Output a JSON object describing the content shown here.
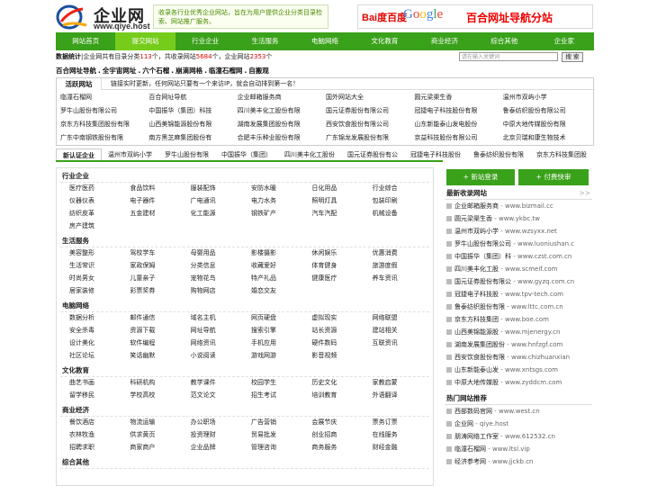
{
  "header": {
    "logo_cn": "企业网",
    "logo_en": "www.qiye.host",
    "intro": "收录各行业优秀企业网站，旨在为用户提供企业分类目录检索、网站推广服务。",
    "banner": {
      "baidu": "Bai度百度",
      "google": "Google",
      "title": "百合网址导航分站"
    }
  },
  "nav": [
    "网站首页",
    "提交网站",
    "行业企业",
    "生活服务",
    "电脑网络",
    "文化教育",
    "商业经济",
    "综合其他",
    "企业家"
  ],
  "stats": {
    "label": "数据统计",
    "text1": "企业网共有目录分类",
    "cats": "113",
    "text2": "个，共收录网站",
    "sites": "5684",
    "text3": "个，企业网站",
    "corp": "2353",
    "text4": "个"
  },
  "search": {
    "placeholder": "请在输入关键词",
    "button": "搜 索"
  },
  "favorites": [
    "百合网址导航",
    "全宇宙网址",
    "六个石榴",
    "崩滴网格",
    "临潼石榴网",
    "自搬观"
  ],
  "live": {
    "title": "活跃网站",
    "desc": "链接实时更新，任何网站只要有一个来访IP，就会自动排到第一名！",
    "links": [
      "临潼石榴网",
      "百合网址导航",
      "企业邮箱服务商",
      "国外网站大全",
      "圆元梁渠生香",
      "温州市双屿小学",
      "罗牛山股份有限公司",
      "中国振华（集团）科技",
      "四川美丰化工股份有限",
      "国元证券股份有限公司",
      "冠捷电子科技股份有限",
      "鲁泰纺织股份有限公司",
      "京东方科技集团股份有限",
      "山西美锦能源股份有限",
      "湖南发展集团股份有限",
      "西安饮食股份有限公司",
      "山东新能泰山发电股份",
      "中原大地传媒股份有限",
      "广东中南钢铁股份有限",
      "南方黑芝麻集团股份有",
      "合肥丰乐种业股份有限",
      "广东锦龙发展股份有限",
      "京益科技股份有限公司",
      "北京贝瑞和康生物技术"
    ]
  },
  "tabs": [
    "新认证企业",
    "温州市双屿小学",
    "罗牛山股份有限",
    "中国振华（集团）",
    "四川美丰化工股份",
    "国元证券股份有公",
    "冠捷电子科技股份",
    "鲁泰纺织股份有限",
    "京东方科技集团股"
  ],
  "side_buttons": {
    "submit": "+ 新站登录",
    "apply": "+ 付费快审"
  },
  "categories": [
    {
      "title": "行业企业",
      "items": [
        "医疗医药",
        "食品饮料",
        "服装配饰",
        "安防水暖",
        "日化用品",
        "行业综合",
        "仪器仪表",
        "电子器件",
        "广电通讯",
        "电力水务",
        "照明灯具",
        "包装印刷",
        "纺织皮革",
        "五金建材",
        "化工能源",
        "钢铁矿产",
        "汽车汽配",
        "机械设备",
        "房产建筑"
      ]
    },
    {
      "title": "生活服务",
      "items": [
        "美容整形",
        "驾校学车",
        "母婴用品",
        "影楼摄影",
        "休闲娱乐",
        "优惠消费",
        "生活常识",
        "家政保姆",
        "分类信息",
        "收藏爱好",
        "体育健身",
        "旅游度假",
        "时尚男女",
        "儿童亲子",
        "宠物花鸟",
        "特产礼品",
        "健康医疗",
        "养车资讯",
        "居家装修",
        "彩票奖券",
        "购物网店",
        "婚恋交友"
      ]
    },
    {
      "title": "电脑网络",
      "items": [
        "数据分析",
        "邮件通信",
        "域名主机",
        "网页硬盘",
        "虚拟现实",
        "网络联盟",
        "安全杀毒",
        "资源下载",
        "网址导航",
        "搜索引擎",
        "站长资源",
        "建站相关",
        "设计美化",
        "软件编程",
        "网络资讯",
        "手机应用",
        "硬件数码",
        "互联资讯",
        "社区论坛",
        "笑话幽默",
        "小说阅读",
        "游戏网游",
        "影音视频"
      ]
    },
    {
      "title": "文化教育",
      "items": [
        "曲艺书画",
        "科研机构",
        "教学课件",
        "校园学生",
        "历史文化",
        "家教启蒙",
        "留学移民",
        "学校高校",
        "范文论文",
        "招生考试",
        "培训教育",
        "外语翻译"
      ]
    },
    {
      "title": "商业经济",
      "items": [
        "餐饮酒店",
        "物流运输",
        "办公职场",
        "广告营销",
        "会展节庆",
        "票务订票",
        "农林牧渔",
        "供求黄页",
        "投资理财",
        "贸易批发",
        "创业招商",
        "在线服务",
        "招聘求职",
        "商家商户",
        "企业品牌",
        "管理咨询",
        "商务服务",
        "财经金融"
      ]
    },
    {
      "title": "综合其他",
      "items": []
    }
  ],
  "side": {
    "new_title": "最新收录网站",
    "more": ">>",
    "new": [
      [
        "企业邮箱服务商",
        "www.bizmail.cc"
      ],
      [
        "圆元梁渠生香",
        "www.ykbc.tw"
      ],
      [
        "温州市双屿小学",
        "www.wzsyxx.net"
      ],
      [
        "罗牛山股份有限公司",
        "www.luoniushan.c"
      ],
      [
        "中国振华（集团）科",
        "www.czst.com.cn"
      ],
      [
        "四川美丰化工股",
        "www.scmeif.com"
      ],
      [
        "国元证券股份有限公",
        "www.gyzq.com.cn"
      ],
      [
        "冠捷电子科技股",
        "www.tpv-tech.com"
      ],
      [
        "鲁泰纺织股份有限",
        "www.lttc.com.cn"
      ],
      [
        "京东方科技集团",
        "www.boe.com"
      ],
      [
        "山西美锦能源股",
        "www.mjenergy.cn"
      ],
      [
        "湖南发展集团股份",
        "www.hnfzgf.com"
      ],
      [
        "西安饮食股份有限",
        "www.chizhuanxian"
      ],
      [
        "山东新能泰山发",
        "www.xntsgs.com"
      ],
      [
        "中原大地传媒股",
        "www.zyddcm.com"
      ]
    ],
    "hot_title": "热门网站推荐",
    "hot": [
      [
        "西部数码官网",
        "www.west.cn"
      ],
      [
        "企业网",
        "qiye.host"
      ],
      [
        "朋涛网络工作室",
        "www.612532.cn"
      ],
      [
        "临潼石榴网",
        "www.ltsl.vip"
      ],
      [
        "经济参考网",
        "www.jjckb.cn"
      ]
    ]
  },
  "colors": {
    "nav": "#3aa11a",
    "nav_active": "#76cc1b",
    "count": "#dd0000"
  }
}
